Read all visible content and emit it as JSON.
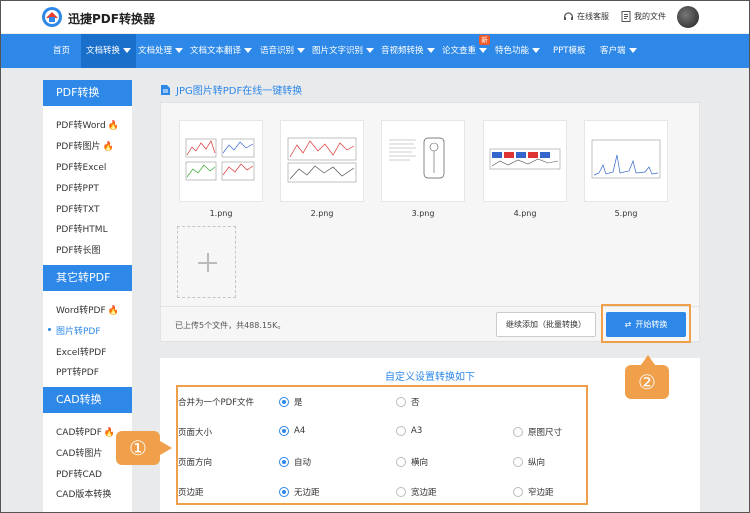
{
  "app": {
    "name": "迅捷PDF转换器"
  },
  "topbar": {
    "service": "在线客服",
    "files": "我的文件"
  },
  "nav": {
    "items": [
      {
        "label": "首页",
        "caret": false
      },
      {
        "label": "文档转换",
        "caret": true
      },
      {
        "label": "文档处理",
        "caret": true
      },
      {
        "label": "文档文本翻译",
        "caret": true
      },
      {
        "label": "语音识别",
        "caret": true
      },
      {
        "label": "图片文字识别",
        "caret": true
      },
      {
        "label": "音视频转换",
        "caret": true
      },
      {
        "label": "论文查重",
        "caret": true
      },
      {
        "label": "特色功能",
        "caret": true
      },
      {
        "label": "PPT模板",
        "caret": false
      },
      {
        "label": "客户端",
        "caret": true
      }
    ],
    "badge": "新"
  },
  "sidebar": {
    "groups": [
      {
        "title": "PDF转换",
        "items": [
          {
            "label": "PDF转Word",
            "hot": true
          },
          {
            "label": "PDF转图片",
            "hot": true
          },
          {
            "label": "PDF转Excel",
            "hot": false
          },
          {
            "label": "PDF转PPT",
            "hot": false
          },
          {
            "label": "PDF转TXT",
            "hot": false
          },
          {
            "label": "PDF转HTML",
            "hot": false
          },
          {
            "label": "PDF转长图",
            "hot": false
          }
        ]
      },
      {
        "title": "其它转PDF",
        "items": [
          {
            "label": "Word转PDF",
            "hot": true
          },
          {
            "label": "图片转PDF",
            "hot": false,
            "active": true
          },
          {
            "label": "Excel转PDF",
            "hot": false
          },
          {
            "label": "PPT转PDF",
            "hot": false
          }
        ]
      },
      {
        "title": "CAD转换",
        "items": [
          {
            "label": "CAD转PDF",
            "hot": true
          },
          {
            "label": "CAD转图片",
            "hot": false
          },
          {
            "label": "PDF转CAD",
            "hot": false
          },
          {
            "label": "CAD版本转换",
            "hot": false
          }
        ]
      }
    ]
  },
  "main": {
    "title": "JPG图片转PDF在线一键转换",
    "files": [
      "1.png",
      "2.png",
      "3.png",
      "4.png",
      "5.png"
    ],
    "status": "已上传5个文件，共488.15K。",
    "continue_button": "继续添加（批量转换）",
    "start_button": "开始转换"
  },
  "settings": {
    "title": "自定义设置转换如下",
    "rows": [
      {
        "label": "合并为一个PDF文件",
        "options": [
          {
            "text": "是",
            "checked": true
          },
          {
            "text": "否",
            "checked": false
          }
        ]
      },
      {
        "label": "页面大小",
        "options": [
          {
            "text": "A4",
            "checked": true
          },
          {
            "text": "A3",
            "checked": false
          },
          {
            "text": "原图尺寸",
            "checked": false
          }
        ]
      },
      {
        "label": "页面方向",
        "options": [
          {
            "text": "自动",
            "checked": true
          },
          {
            "text": "横向",
            "checked": false
          },
          {
            "text": "纵向",
            "checked": false
          }
        ]
      },
      {
        "label": "页边距",
        "options": [
          {
            "text": "无边距",
            "checked": true
          },
          {
            "text": "宽边距",
            "checked": false
          },
          {
            "text": "窄边距",
            "checked": false
          }
        ]
      }
    ]
  },
  "annotations": {
    "one": "①",
    "two": "②"
  },
  "colors": {
    "primary": "#2d88e8",
    "highlight": "#f0a04a",
    "hot": "#f0641e"
  }
}
